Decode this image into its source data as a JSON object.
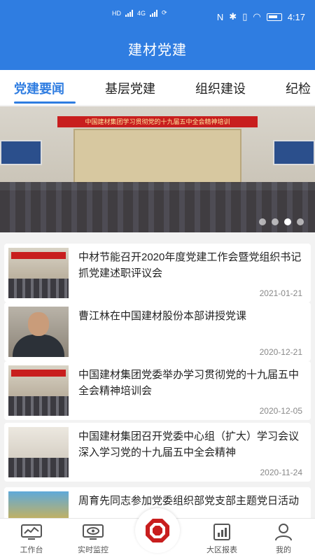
{
  "status": {
    "time": "4:17"
  },
  "app": {
    "title": "建材党建"
  },
  "tabs": [
    {
      "label": "党建要闻",
      "active": true
    },
    {
      "label": "基层党建"
    },
    {
      "label": "组织建设"
    },
    {
      "label": "纪检"
    }
  ],
  "banner": {
    "slogan": "中国建材集团学习贯彻党的十九届五中全会精神培训",
    "slides": 4,
    "active_slide": 3
  },
  "news": [
    {
      "title": "中材节能召开2020年度党建工作会暨党组织书记抓党建述职评议会",
      "date": "2021-01-21"
    },
    {
      "title": "曹江林在中国建材股份本部讲授党课",
      "date": "2020-12-21"
    },
    {
      "title": "中国建材集团党委举办学习贯彻党的十九届五中全会精神培训会",
      "date": "2020-12-05"
    },
    {
      "title": "中国建材集团召开党委中心组（扩大）学习会议深入学习党的十九届五中全会精神",
      "date": "2020-11-24"
    },
    {
      "title": "周育先同志参加党委组织部党支部主题党日活动",
      "date": ""
    }
  ],
  "bottom_nav": [
    {
      "label": "工作台",
      "icon": "dashboard-icon"
    },
    {
      "label": "实时监控",
      "icon": "eye-monitor-icon"
    },
    {
      "label": "",
      "icon": "party-emblem-icon"
    },
    {
      "label": "大区报表",
      "icon": "report-icon"
    },
    {
      "label": "我的",
      "icon": "user-icon"
    }
  ],
  "colors": {
    "primary": "#2f7de1",
    "accent_red": "#c81e1e"
  }
}
